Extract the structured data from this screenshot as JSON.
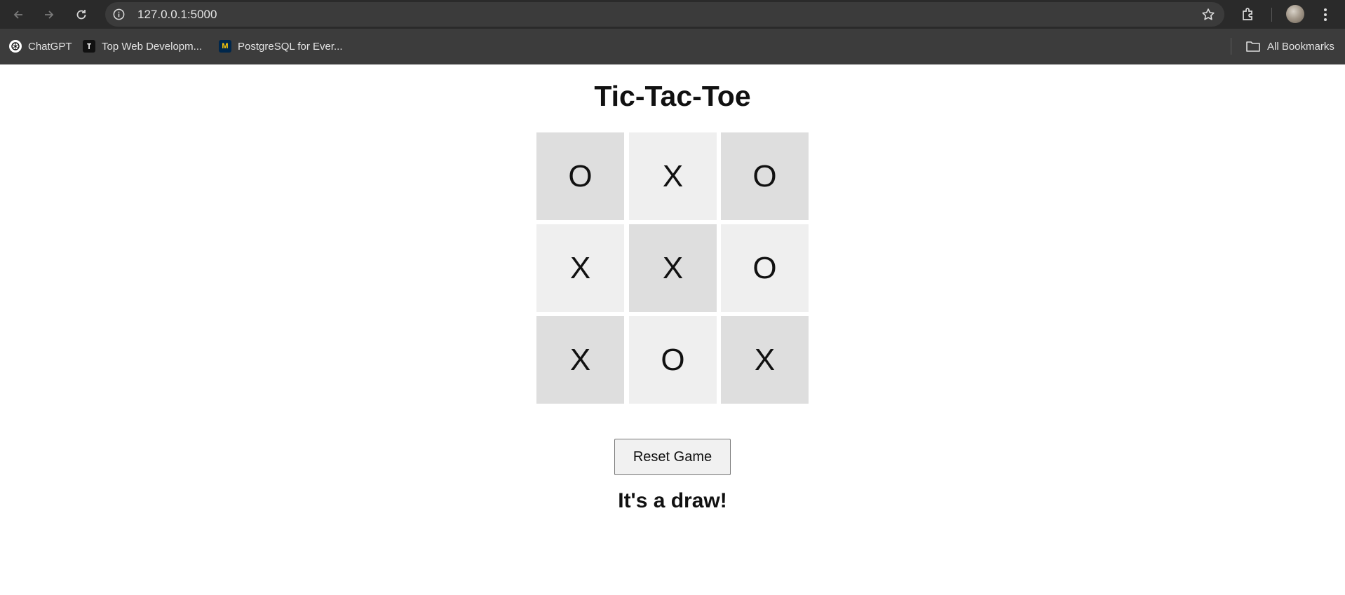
{
  "browser": {
    "url": "127.0.0.1:5000",
    "bookmarks": [
      {
        "label": "ChatGPT",
        "icon": "chatgpt-icon"
      },
      {
        "label": "Top Web Developm...",
        "icon": "tw-icon"
      },
      {
        "label": "PostgreSQL for Ever...",
        "icon": "michigan-m-icon"
      }
    ],
    "all_bookmarks_label": "All Bookmarks"
  },
  "game": {
    "title": "Tic-Tac-Toe",
    "board": [
      "O",
      "X",
      "O",
      "X",
      "X",
      "O",
      "X",
      "O",
      "X"
    ],
    "reset_label": "Reset Game",
    "status": "It's a draw!"
  }
}
